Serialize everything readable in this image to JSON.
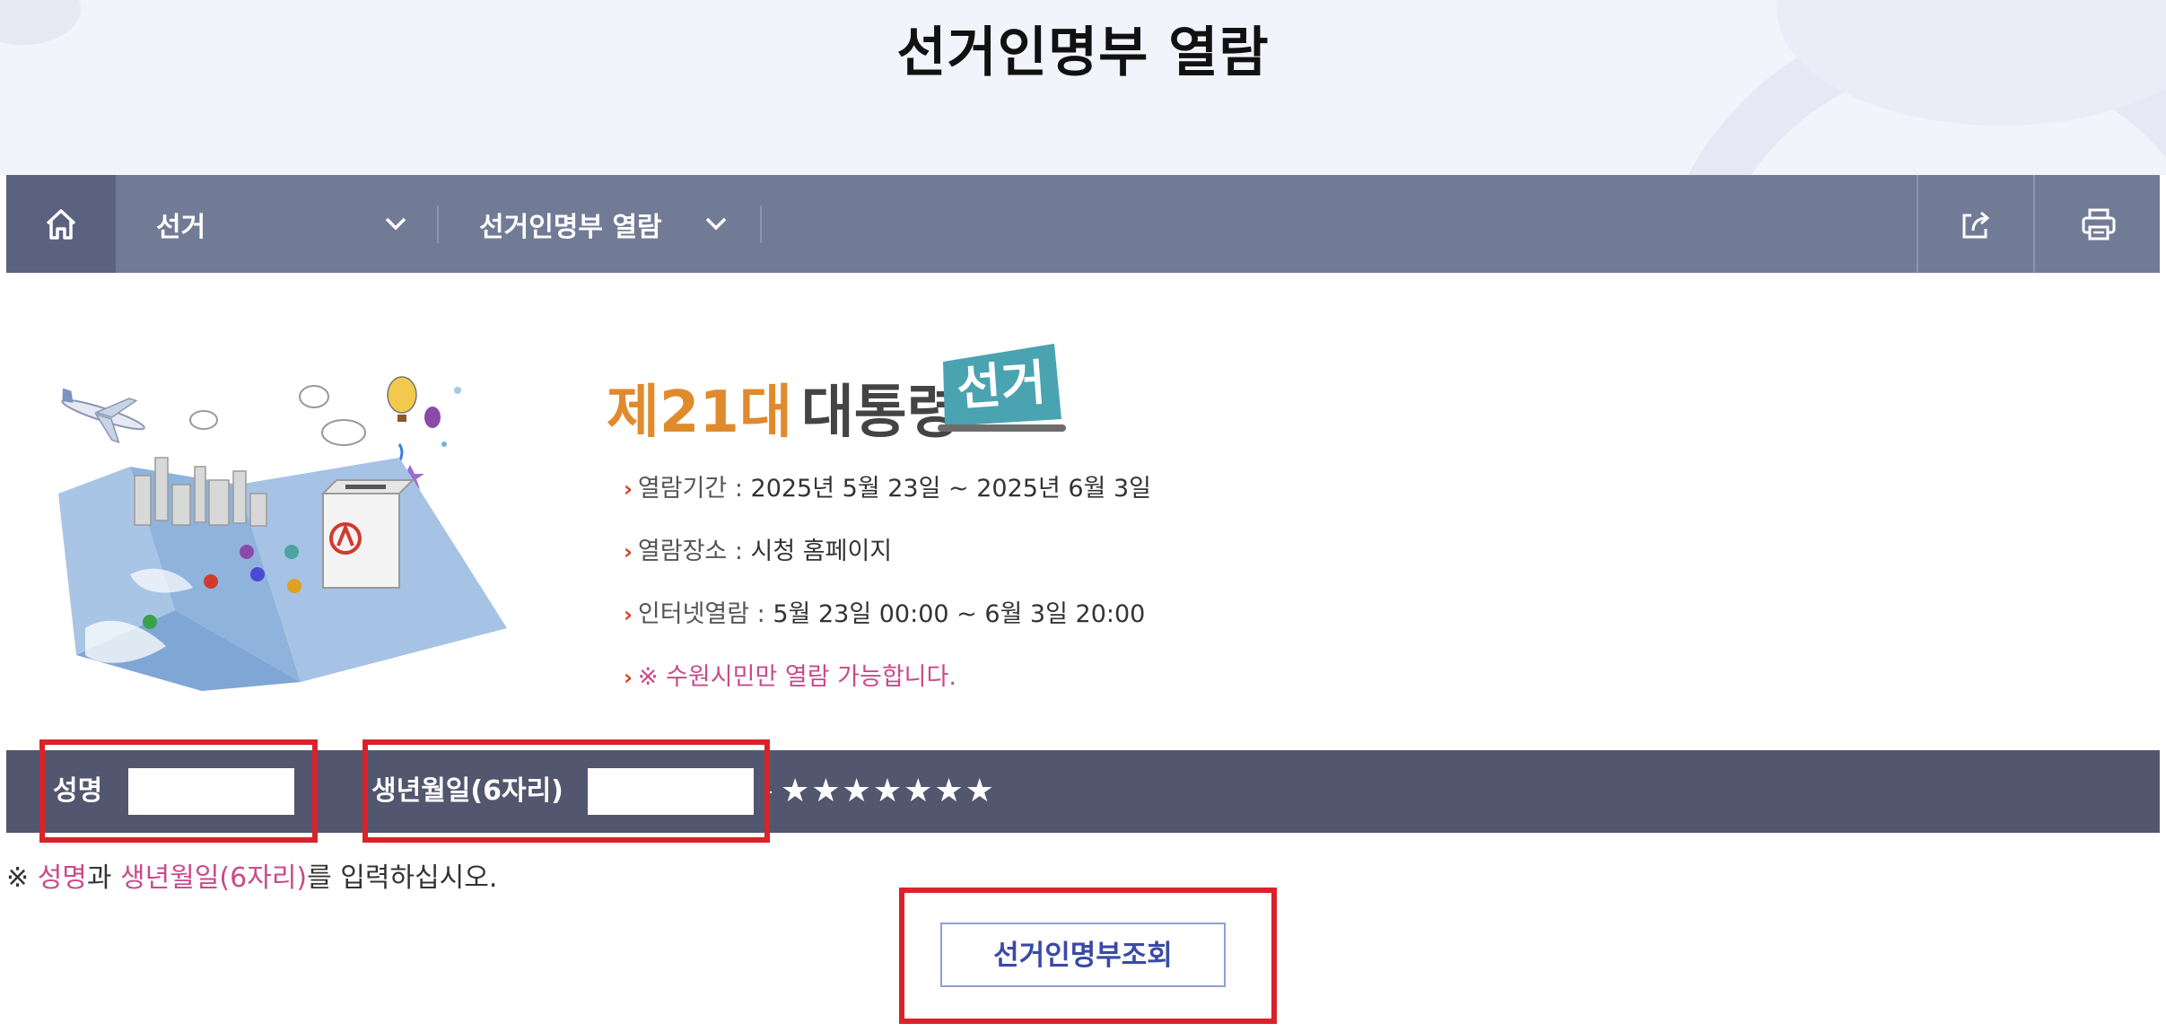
{
  "page": {
    "title": "선거인명부 열람"
  },
  "nav": {
    "home_icon": "home-icon",
    "menu1": "선거",
    "menu2": "선거인명부 열람",
    "share_icon": "share-icon",
    "print_icon": "print-icon"
  },
  "election": {
    "ordinal": "제21대",
    "kind": "대통령",
    "badge": "선거",
    "info": [
      {
        "label": "열람기간 : ",
        "value": "2025년 5월 23일 ~ 2025년 6월 3일"
      },
      {
        "label": "열람장소 : ",
        "value": "시청 홈페이지"
      },
      {
        "label": "인터넷열람 : ",
        "value": "5월 23일 00:00 ~ 6월 3일 20:00"
      }
    ],
    "notice": "※ 수원시민만 열람 가능합니다."
  },
  "form": {
    "name_label": "성명",
    "name_value": "",
    "birth_label": "생년월일(6자리)",
    "birth_value": "",
    "separator": "-",
    "masked": "★★★★★★★"
  },
  "instruction": {
    "prefix": "※ ",
    "name": "성명",
    "conj": "과 ",
    "birth": "생년월일(6자리)",
    "suffix": "를 입력하십시오."
  },
  "search_button": "선거인명부조회",
  "colors": {
    "nav_bg": "#727b96",
    "form_bg": "#52566e",
    "highlight": "#d9232a",
    "accent_orange": "#e08a2e",
    "accent_pink": "#c94a8a",
    "button_text": "#3a4aa6"
  }
}
